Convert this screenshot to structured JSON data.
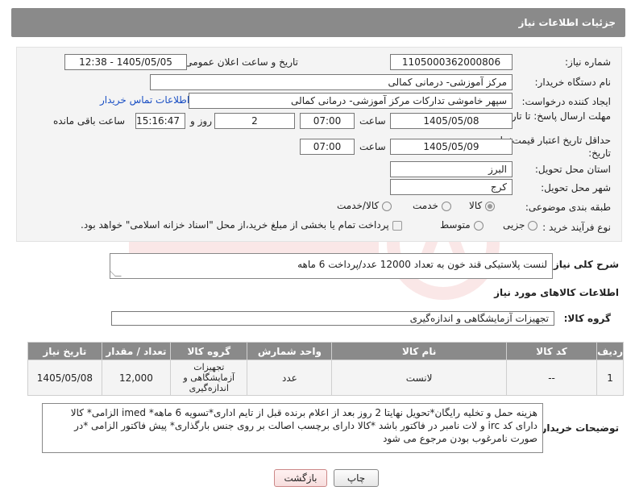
{
  "header": {
    "title": "جزئیات اطلاعات نیاز"
  },
  "form": {
    "need_number_label": "شماره نیاز:",
    "need_number": "1105000362000806",
    "announce_label": "تاریخ و ساعت اعلان عمومی:",
    "announce_value": "1405/05/05 - 12:38",
    "buyer_org_label": "نام دستگاه خریدار:",
    "buyer_org": "مرکز آموزشی- درمانی کمالی",
    "requester_label": "ایجاد کننده درخواست:",
    "requester": "سپهر خاموشی تدارکات مرکز آموزشی- درمانی کمالی",
    "contact_link": "اطلاعات تماس خریدار",
    "reply_deadline_label": "مهلت ارسال پاسخ: تا تاریخ:",
    "reply_date": "1405/05/08",
    "time_label": "ساعت",
    "reply_time": "07:00",
    "days_value": "2",
    "days_label": "روز و",
    "remaining_time": "15:16:47",
    "remaining_label": "ساعت باقی مانده",
    "price_validity_label": "حداقل تاریخ اعتبار قیمت: تا تاریخ:",
    "price_date": "1405/05/09",
    "price_time": "07:00",
    "province_label": "استان محل تحویل:",
    "province": "البرز",
    "city_label": "شهر محل تحویل:",
    "city": "کرج",
    "category_label": "طبقه بندی موضوعی:",
    "category_options": [
      "کالا",
      "خدمت",
      "کالا/خدمت"
    ],
    "process_label": "نوع فرآیند خرید :",
    "process_options": [
      "جزیی",
      "متوسط"
    ],
    "payment_note": "پرداخت تمام یا بخشی از مبلغ خرید،از محل \"اسناد خزانه اسلامی\" خواهد بود."
  },
  "summary": {
    "label": "شرح کلی نیاز:",
    "text": "لنست پلاستیکی قند خون به تعداد 12000 عدد/پرداخت 6 ماهه"
  },
  "goods_info": {
    "title": "اطلاعات کالاهای مورد نیاز",
    "group_label": "گروه کالا:",
    "group_value": "تجهیزات آزمایشگاهی و اندازه‌گیری"
  },
  "table": {
    "headers": [
      "ردیف",
      "کد کالا",
      "نام کالا",
      "واحد شمارش",
      "گروه کالا",
      "تعداد / مقدار",
      "تاریخ نیاز"
    ],
    "rows": [
      {
        "index": "1",
        "code": "--",
        "name": "لانست",
        "unit": "عدد",
        "group": "تجهیزات آزمایشگاهی و اندازه‌گیری",
        "quantity": "12,000",
        "date": "1405/05/08"
      }
    ]
  },
  "notes": {
    "label": "توضیحات خریدار:",
    "text": "هزینه حمل و تخلیه رایگان*تحویل نهایتا 2 روز بعد از اعلام برنده قبل از تایم اداری*تسویه 6 ماهه* imed الزامی* کالا دارای کد irc و لات نامبر در فاکتور باشد *کالا دارای برچسب اصالت بر روی جنس بارگذاری* پیش فاکتور الزامی *در صورت نامرغوب بودن مرجوع می شود"
  },
  "buttons": {
    "print": "چاپ",
    "back": "بازگشت"
  }
}
